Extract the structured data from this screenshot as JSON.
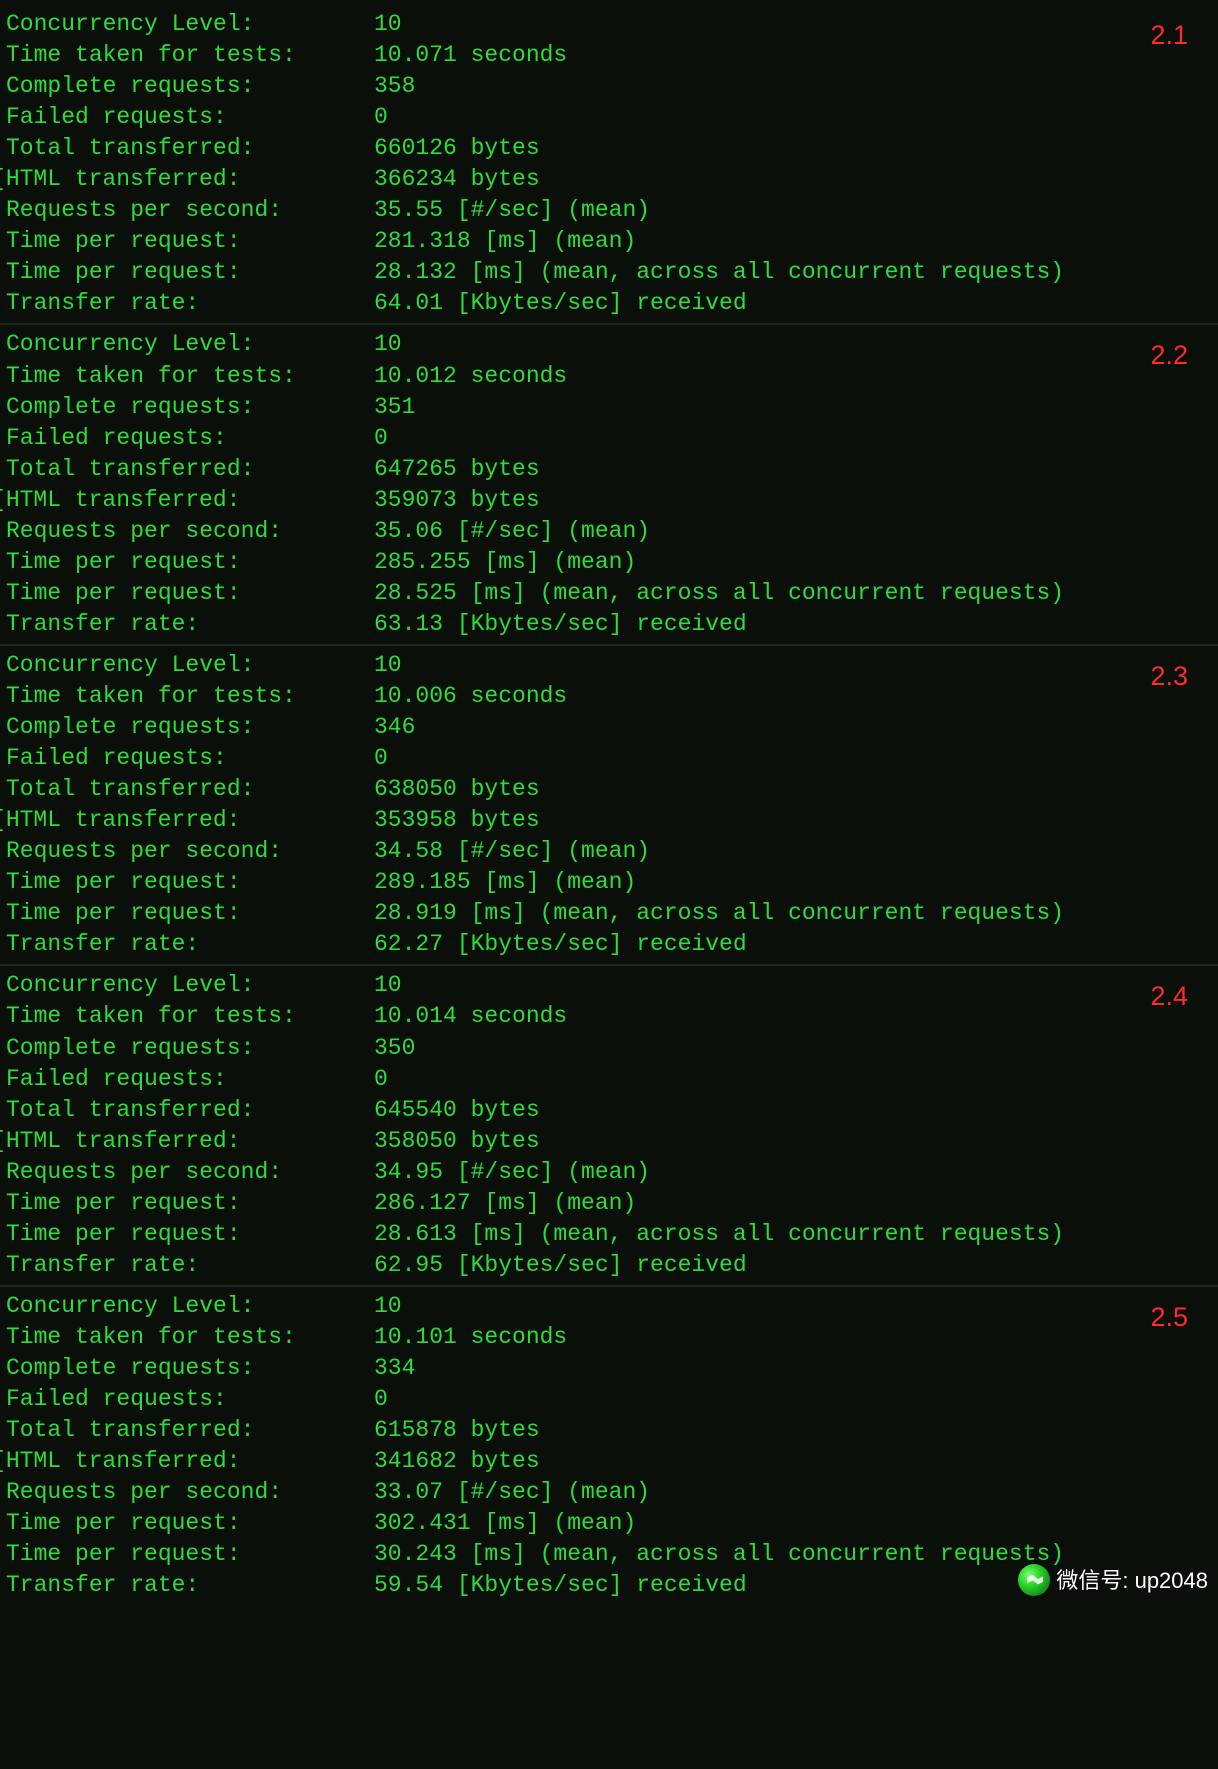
{
  "watermark": {
    "label": "微信号: up2048"
  },
  "labels": {
    "concurrency": "Concurrency Level:",
    "time_taken": "Time taken for tests:",
    "complete": "Complete requests:",
    "failed": "Failed requests:",
    "total_transferred": "Total transferred:",
    "html_transferred": "HTML transferred:",
    "rps": "Requests per second:",
    "tpr": "Time per request:",
    "tpr2": "Time per request:",
    "transfer": "Transfer rate:"
  },
  "blocks": [
    {
      "version": "2.1",
      "concurrency": "10",
      "time_taken": "10.071 seconds",
      "complete": "358",
      "failed": "0",
      "total_transferred": "660126 bytes",
      "html_transferred": "366234 bytes",
      "rps": "35.55 [#/sec] (mean)",
      "tpr": "281.318 [ms] (mean)",
      "tpr2": "28.132 [ms] (mean, across all concurrent requests)",
      "transfer": "64.01 [Kbytes/sec] received"
    },
    {
      "version": "2.2",
      "concurrency": "10",
      "time_taken": "10.012 seconds",
      "complete": "351",
      "failed": "0",
      "total_transferred": "647265 bytes",
      "html_transferred": "359073 bytes",
      "rps": "35.06 [#/sec] (mean)",
      "tpr": "285.255 [ms] (mean)",
      "tpr2": "28.525 [ms] (mean, across all concurrent requests)",
      "transfer": "63.13 [Kbytes/sec] received"
    },
    {
      "version": "2.3",
      "concurrency": "10",
      "time_taken": "10.006 seconds",
      "complete": "346",
      "failed": "0",
      "total_transferred": "638050 bytes",
      "html_transferred": "353958 bytes",
      "rps": "34.58 [#/sec] (mean)",
      "tpr": "289.185 [ms] (mean)",
      "tpr2": "28.919 [ms] (mean, across all concurrent requests)",
      "transfer": "62.27 [Kbytes/sec] received"
    },
    {
      "version": "2.4",
      "concurrency": "10",
      "time_taken": "10.014 seconds",
      "complete": "350",
      "failed": "0",
      "total_transferred": "645540 bytes",
      "html_transferred": "358050 bytes",
      "rps": "34.95 [#/sec] (mean)",
      "tpr": "286.127 [ms] (mean)",
      "tpr2": "28.613 [ms] (mean, across all concurrent requests)",
      "transfer": "62.95 [Kbytes/sec] received"
    },
    {
      "version": "2.5",
      "concurrency": "10",
      "time_taken": "10.101 seconds",
      "complete": "334",
      "failed": "0",
      "total_transferred": "615878 bytes",
      "html_transferred": "341682 bytes",
      "rps": "33.07 [#/sec] (mean)",
      "tpr": "302.431 [ms] (mean)",
      "tpr2": "30.243 [ms] (mean, across all concurrent requests)",
      "transfer": "59.54 [Kbytes/sec] received"
    }
  ]
}
